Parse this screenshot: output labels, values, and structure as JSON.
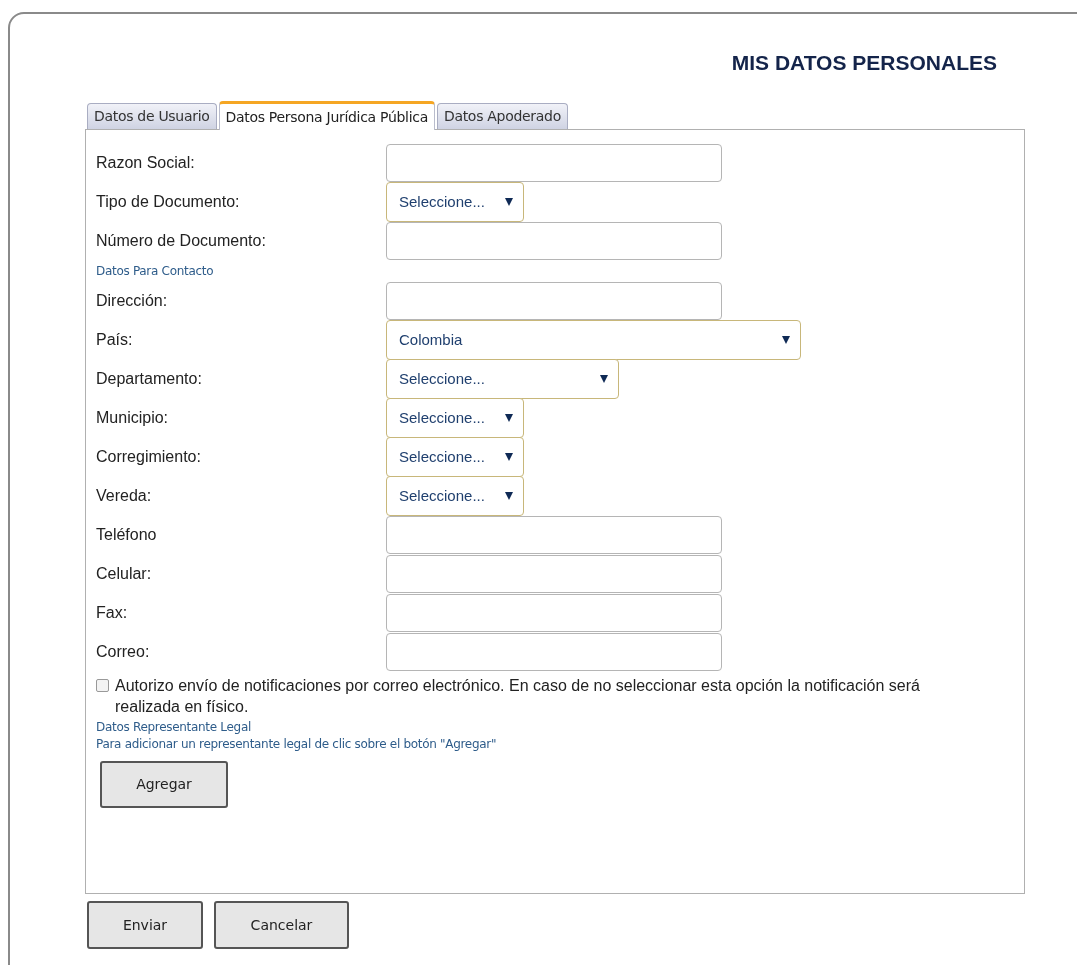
{
  "title": "MIS DATOS PERSONALES",
  "tabs": [
    {
      "label": "Datos de Usuario",
      "selected": false
    },
    {
      "label": "Datos Persona Jurídica Pública",
      "selected": true
    },
    {
      "label": "Datos Apoderado",
      "selected": false
    }
  ],
  "fields": [
    {
      "kind": "text",
      "label": "Razon Social:"
    },
    {
      "kind": "select",
      "label": "Tipo de Documento:",
      "value": "Seleccione..."
    },
    {
      "kind": "text",
      "label": "Número de Documento:"
    },
    {
      "kind": "caption",
      "label": "Datos Para Contacto"
    },
    {
      "kind": "text",
      "label": "Dirección:"
    },
    {
      "kind": "select",
      "label": "País:",
      "value": "Colombia"
    },
    {
      "kind": "select",
      "label": "Departamento:",
      "value": "Seleccione..."
    },
    {
      "kind": "select",
      "label": "Municipio:",
      "value": "Seleccione..."
    },
    {
      "kind": "select",
      "label": "Corregimiento:",
      "value": "Seleccione..."
    },
    {
      "kind": "select",
      "label": "Vereda:",
      "value": "Seleccione..."
    },
    {
      "kind": "text",
      "label": "Teléfono"
    },
    {
      "kind": "text",
      "label": "Celular:"
    },
    {
      "kind": "text",
      "label": "Fax:"
    },
    {
      "kind": "text",
      "label": "Correo:"
    }
  ],
  "consent": {
    "checked": false,
    "text": "Autorizo envío de notificaciones por correo electrónico. En caso de no seleccionar esta opción la notificación será realizada en físico."
  },
  "legal_rep": {
    "heading": "Datos Representante Legal",
    "hint": "Para adicionar un representante legal de clic sobre el botón \"Agregar\"",
    "button": "Agregar"
  },
  "buttons": [
    "Enviar",
    "Cancelar"
  ]
}
